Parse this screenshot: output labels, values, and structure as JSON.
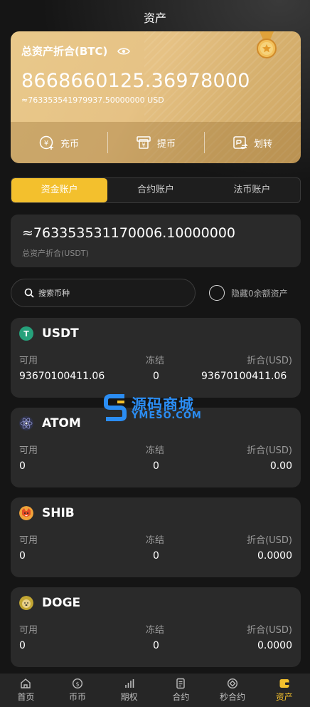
{
  "header": {
    "title": "资产"
  },
  "card": {
    "label": "总资产折合(BTC)",
    "amount": "8668660125.36978000",
    "usd": "≈763353541979937.50000000 USD",
    "actions": [
      {
        "label": "充币",
        "icon": "deposit-icon"
      },
      {
        "label": "提币",
        "icon": "withdraw-icon"
      },
      {
        "label": "划转",
        "icon": "transfer-icon"
      }
    ]
  },
  "tabs": [
    {
      "label": "资金账户",
      "active": true
    },
    {
      "label": "合约账户",
      "active": false
    },
    {
      "label": "法币账户",
      "active": false
    }
  ],
  "total": {
    "amount": "≈763353531170006.10000000",
    "label": "总资产折合(USDT)"
  },
  "search": {
    "placeholder": "搜索币种"
  },
  "hide_zero": {
    "label": "隐藏0余额资产"
  },
  "columns": {
    "available": "可用",
    "frozen": "冻结",
    "value": "折合(USD)"
  },
  "coins": [
    {
      "name": "USDT",
      "available": "93670100411.06",
      "frozen": "0",
      "value": "93670100411.06",
      "color": "#26a17b"
    },
    {
      "name": "ATOM",
      "available": "0",
      "frozen": "0",
      "value": "0.00",
      "color": "#2e3148"
    },
    {
      "name": "SHIB",
      "available": "0",
      "frozen": "0",
      "value": "0.0000",
      "color": "#e44d26"
    },
    {
      "name": "DOGE",
      "available": "0",
      "frozen": "0",
      "value": "0.0000",
      "color": "#c2a633"
    }
  ],
  "watermark": {
    "title": "源码商城",
    "sub": "YMESO.COM"
  },
  "tabbar": [
    {
      "label": "首页",
      "icon": "home-icon",
      "active": false
    },
    {
      "label": "币币",
      "icon": "coin-icon",
      "active": false
    },
    {
      "label": "期权",
      "icon": "bars-icon",
      "active": false
    },
    {
      "label": "合约",
      "icon": "document-icon",
      "active": false
    },
    {
      "label": "秒合约",
      "icon": "target-icon",
      "active": false
    },
    {
      "label": "资产",
      "icon": "wallet-icon",
      "active": true
    }
  ],
  "colors": {
    "accent": "#f3c02d",
    "card_gold": "#e6c285",
    "background": "#151515",
    "panel": "#2a2a2a"
  }
}
